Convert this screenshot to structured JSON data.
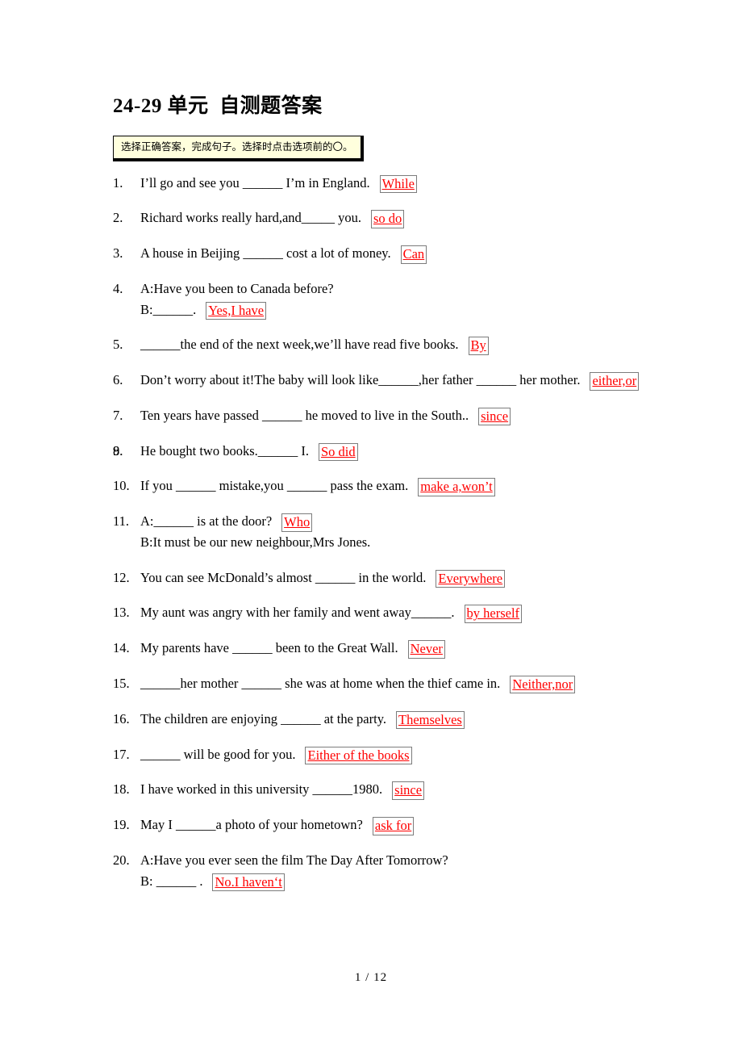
{
  "document": {
    "title": "24-29 单元  自测题答案",
    "instruction": "选择正确答案，完成句子。选择时点击选项前的〇。",
    "footer": "1  / 12",
    "answer_color": "#ff0000",
    "instruction_bg": "#ffffdd",
    "answer_border_color": "#7c7c7c"
  },
  "questions": [
    {
      "num": "1.",
      "lines": [
        "I’ll go and see you ______ I’m in England."
      ],
      "answer": "While"
    },
    {
      "num": "2.",
      "lines": [
        "Richard works really hard,and_____ you."
      ],
      "answer": "so do"
    },
    {
      "num": "3.",
      "lines": [
        "A house in Beijing ______ cost a lot of money."
      ],
      "answer": "Can"
    },
    {
      "num": "4.",
      "lines": [
        "A:Have you been to Canada before?",
        "B:______."
      ],
      "answer": "Yes,I have"
    },
    {
      "num": "5.",
      "lines": [
        "______the end of the next week,we’ll have read five books."
      ],
      "answer": "By"
    },
    {
      "num": "6.",
      "lines": [
        "Don’t worry about it!The baby will look like______,her father ______ her mother."
      ],
      "answer": "either,or"
    },
    {
      "num": "7.",
      "lines": [
        "Ten years have passed ______ he moved to live in the South.."
      ],
      "answer": "since"
    },
    {
      "num": "8.",
      "lines": [
        ""
      ],
      "answer": ""
    },
    {
      "num": "9.",
      "lines": [
        "He bought two books.______ I."
      ],
      "answer": "So did"
    },
    {
      "num": "10.",
      "lines": [
        "If you ______ mistake,you ______ pass the exam."
      ],
      "answer": "make a,won’t"
    },
    {
      "num": "11.",
      "lines": [
        "A:______ is at the door?",
        "B:It must be our new neighbour,Mrs Jones."
      ],
      "answer": "Who",
      "answer_on_line": 0
    },
    {
      "num": "12.",
      "lines": [
        "You can see McDonald’s almost ______ in the world."
      ],
      "answer": "Everywhere"
    },
    {
      "num": "13.",
      "lines": [
        "My aunt was angry with her family and went away______."
      ],
      "answer": "by herself"
    },
    {
      "num": "14.",
      "lines": [
        "My parents have ______ been to the Great Wall."
      ],
      "answer": "Never"
    },
    {
      "num": "15.",
      "lines": [
        "______her mother ______ she was at home when the thief came in."
      ],
      "answer": "Neither,nor"
    },
    {
      "num": "16.",
      "lines": [
        "The children are enjoying ______ at the party."
      ],
      "answer": "Themselves"
    },
    {
      "num": "17.",
      "lines": [
        "______ will be good for you."
      ],
      "answer": "Either of the books"
    },
    {
      "num": "18.",
      "lines": [
        "I have worked in this university ______1980."
      ],
      "answer": "since"
    },
    {
      "num": "19.",
      "lines": [
        "May I ______a photo of your hometown?"
      ],
      "answer": "ask for"
    },
    {
      "num": "20.",
      "lines": [
        "A:Have you ever seen the film The Day After Tomorrow?",
        "B: ______ ."
      ],
      "answer": "No.I haven‘t"
    }
  ]
}
